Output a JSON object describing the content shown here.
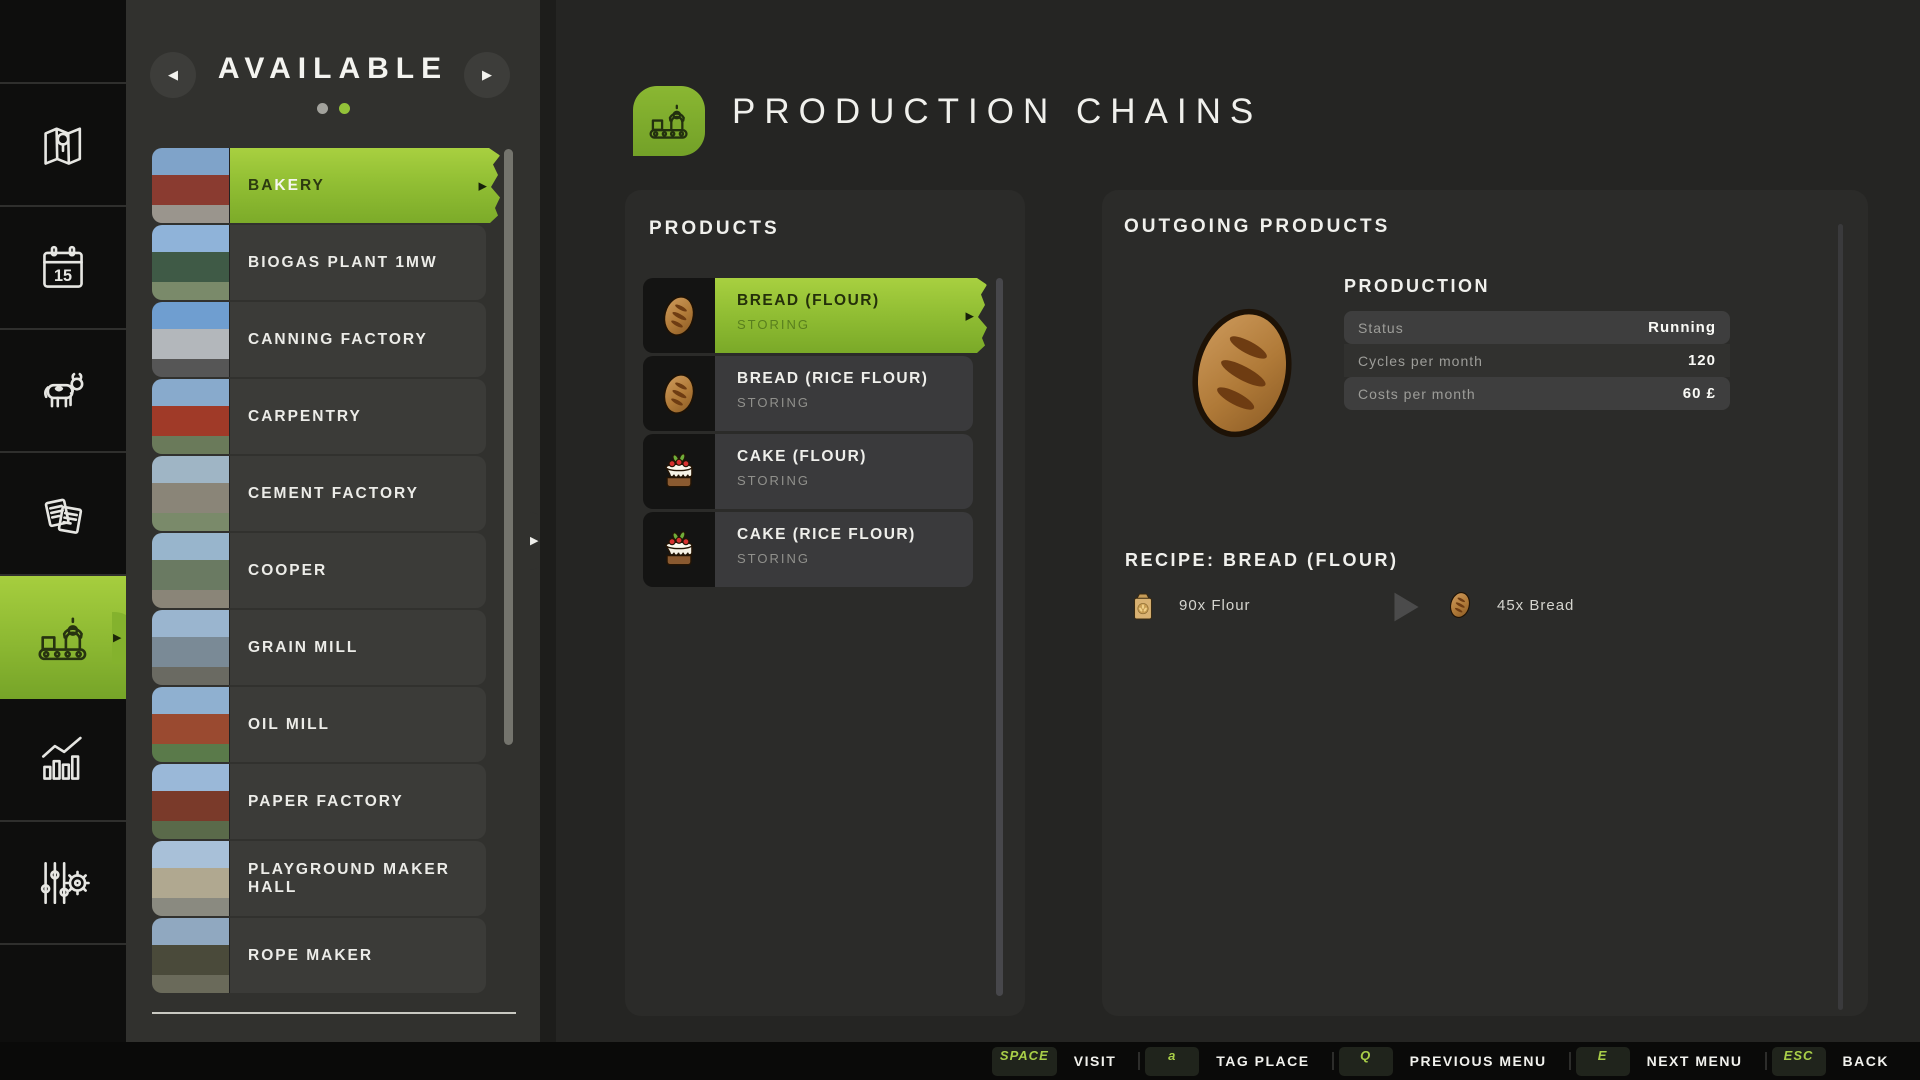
{
  "colors": {
    "accent_green": "#8dc63f",
    "key_green": "#a9cf48",
    "selected_text_dark": "#24300a"
  },
  "sidebar": {
    "items": [
      {
        "id": "map",
        "icon": "map-icon",
        "active": false
      },
      {
        "id": "calendar",
        "icon": "calendar-icon",
        "active": false
      },
      {
        "id": "animals",
        "icon": "cow-icon",
        "active": false
      },
      {
        "id": "contracts",
        "icon": "documents-icon",
        "active": false
      },
      {
        "id": "production",
        "icon": "production-icon",
        "active": true
      },
      {
        "id": "statistics",
        "icon": "stats-icon",
        "active": false
      },
      {
        "id": "settings",
        "icon": "sliders-gear-icon",
        "active": false
      }
    ]
  },
  "available_panel": {
    "title": "AVAILABLE",
    "pages": 2,
    "active_page": 2,
    "buildings": [
      {
        "label": "BAKERY",
        "selected": true,
        "label_parts": [
          {
            "text": "BA",
            "tone": "dark"
          },
          {
            "text": "KE",
            "tone": "light"
          },
          {
            "text": "RY",
            "tone": "dark"
          }
        ],
        "thumb": [
          "#7fa3c9",
          "#8a3b30",
          "#9a958d"
        ]
      },
      {
        "label": "BIOGAS PLANT 1MW",
        "selected": false,
        "thumb": [
          "#8fb3d9",
          "#3f5a46",
          "#7a8a6a"
        ]
      },
      {
        "label": "CANNING FACTORY",
        "selected": false,
        "thumb": [
          "#6f9ed0",
          "#b3b7bb",
          "#565656"
        ]
      },
      {
        "label": "CARPENTRY",
        "selected": false,
        "thumb": [
          "#88aacc",
          "#a03a28",
          "#6a7a5a"
        ]
      },
      {
        "label": "CEMENT FACTORY",
        "selected": false,
        "thumb": [
          "#9fb5c5",
          "#8a8578",
          "#7a8a6a"
        ]
      },
      {
        "label": "COOPER",
        "selected": false,
        "thumb": [
          "#98b5cc",
          "#6a7a62",
          "#8a8578"
        ]
      },
      {
        "label": "GRAIN MILL",
        "selected": false,
        "thumb": [
          "#9ab5cf",
          "#7a8a96",
          "#6a6a62"
        ]
      },
      {
        "label": "OIL MILL",
        "selected": false,
        "thumb": [
          "#8fb0d0",
          "#9a4a30",
          "#5a7a4a"
        ]
      },
      {
        "label": "PAPER FACTORY",
        "selected": false,
        "thumb": [
          "#9ab8d8",
          "#7a3a2a",
          "#5a6a4a"
        ]
      },
      {
        "label": "PLAYGROUND MAKER HALL",
        "selected": false,
        "thumb": [
          "#a8c0d8",
          "#b0a890",
          "#8a8a80"
        ]
      },
      {
        "label": "ROPE MAKER",
        "selected": false,
        "thumb": [
          "#90a8c0",
          "#4a4a3a",
          "#6a6a5a"
        ]
      }
    ]
  },
  "header": {
    "title": "PRODUCTION CHAINS",
    "icon": "production-icon"
  },
  "products_panel": {
    "heading": "PRODUCTS",
    "items": [
      {
        "name": "BREAD (FLOUR)",
        "status": "STORING",
        "icon": "bread-icon",
        "selected": true
      },
      {
        "name": "BREAD (RICE FLOUR)",
        "status": "STORING",
        "icon": "bread-icon",
        "selected": false
      },
      {
        "name": "CAKE (FLOUR)",
        "status": "STORING",
        "icon": "cake-icon",
        "selected": false
      },
      {
        "name": "CAKE (RICE FLOUR)",
        "status": "STORING",
        "icon": "cake-icon",
        "selected": false
      }
    ]
  },
  "outgoing_panel": {
    "heading": "OUTGOING PRODUCTS",
    "product_image": "bread-icon",
    "production": {
      "heading": "PRODUCTION",
      "rows": [
        {
          "label": "Status",
          "value": "Running"
        },
        {
          "label": "Cycles per month",
          "value": "120"
        },
        {
          "label": "Costs per month",
          "value": "60 £"
        }
      ]
    },
    "recipe": {
      "heading": "RECIPE: BREAD (FLOUR)",
      "input": {
        "quantity": "90x Flour",
        "icon": "flour-bag-icon"
      },
      "arrow_icon": "play-arrow-icon",
      "output": {
        "quantity": "45x Bread",
        "icon": "bread-icon"
      }
    }
  },
  "hotbar": {
    "actions": [
      {
        "key": "SPACE",
        "label": "VISIT"
      },
      {
        "key": "a",
        "label": "TAG PLACE"
      },
      {
        "key": "Q",
        "label": "PREVIOUS MENU"
      },
      {
        "key": "E",
        "label": "NEXT MENU"
      },
      {
        "key": "ESC",
        "label": "BACK"
      }
    ]
  }
}
